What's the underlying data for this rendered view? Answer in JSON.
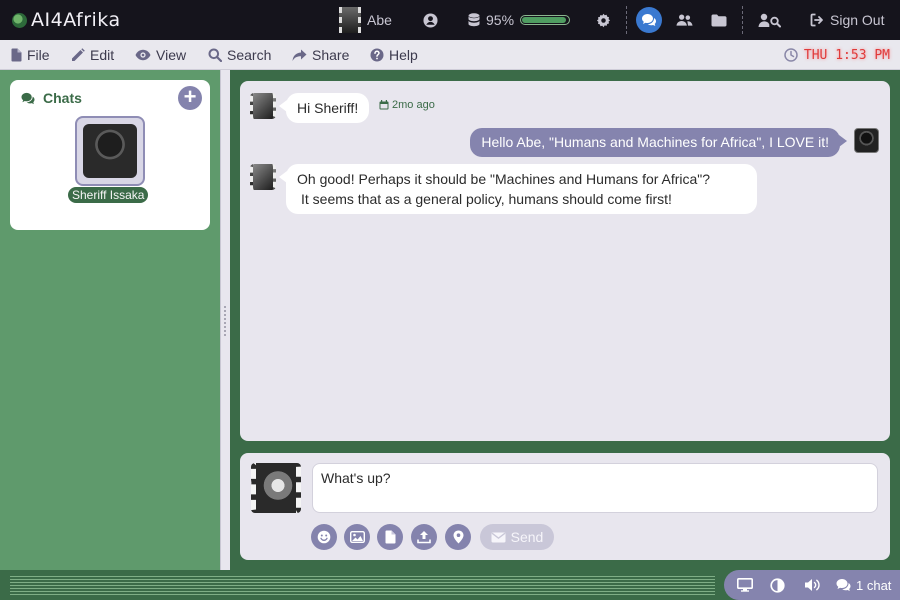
{
  "app": {
    "title": "AI4Afrika"
  },
  "header": {
    "user_name": "Abe",
    "storage_percent_label": "95%",
    "storage_fraction": 0.95,
    "sign_out_label": "Sign Out"
  },
  "menu": {
    "file": "File",
    "edit": "Edit",
    "view": "View",
    "search": "Search",
    "share": "Share",
    "help": "Help"
  },
  "clock": {
    "text": "THU 1:53 PM"
  },
  "chats": {
    "title": "Chats",
    "contact_name": "Sheriff Issaka"
  },
  "messages": [
    {
      "direction": "in",
      "text": "Hi Sheriff!",
      "time": "2mo ago"
    },
    {
      "direction": "out",
      "text": "Hello Abe, \"Humans and Machines for Africa\", I LOVE it!"
    },
    {
      "direction": "in",
      "line1": "Oh good!   Perhaps it should be \"Machines and Humans for Africa\"?",
      "line2": "It seems that as a general policy, humans should come first!"
    }
  ],
  "composer": {
    "value": "What's up?",
    "send_label": "Send"
  },
  "status": {
    "chat_count_label": "1 chat"
  },
  "colors": {
    "brand_green": "#3b6b48",
    "accent_purple": "#8584ae",
    "active_blue": "#3a79d0",
    "clock_red": "#e03a3a"
  },
  "icons": [
    "globe-icon",
    "user-circle-icon",
    "database-icon",
    "gear-icon",
    "chat-icon",
    "users-icon",
    "folder-icon",
    "user-search-icon",
    "sign-out-icon",
    "file-icon",
    "edit-icon",
    "eye-icon",
    "search-icon",
    "share-icon",
    "help-icon",
    "clock-icon",
    "calendar-icon",
    "plus-icon",
    "smile-icon",
    "image-icon",
    "document-icon",
    "upload-icon",
    "location-icon",
    "envelope-icon",
    "monitor-icon",
    "contrast-icon",
    "volume-icon"
  ]
}
